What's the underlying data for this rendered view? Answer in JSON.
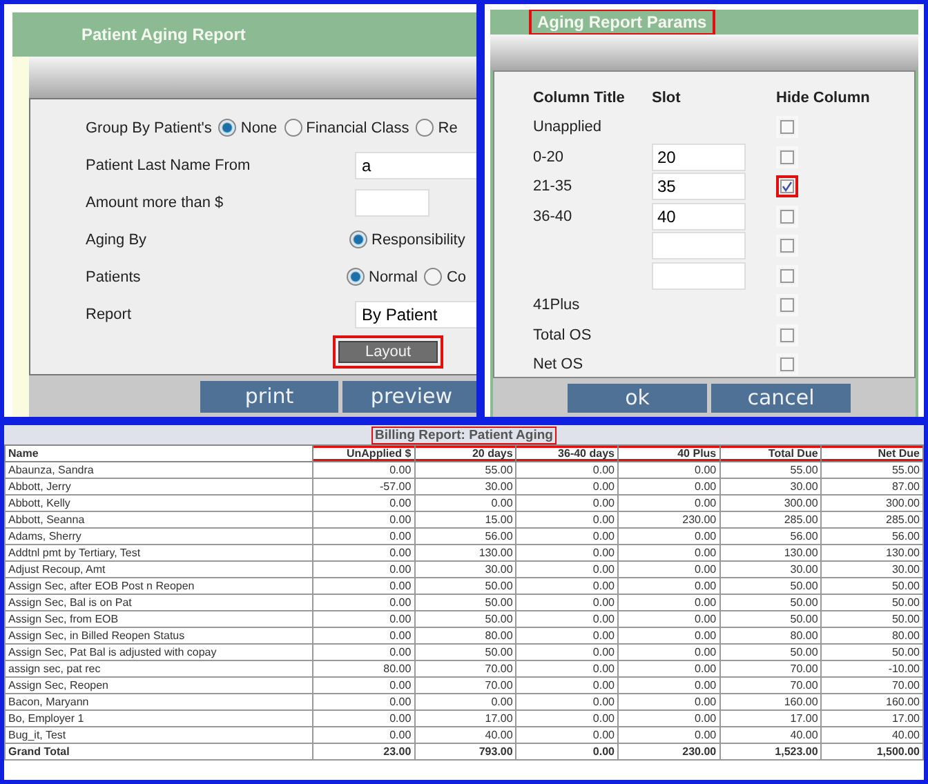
{
  "patient_aging_report": {
    "title": "Patient Aging Report",
    "group_by": {
      "label": "Group By Patient's",
      "options": [
        {
          "label": "None",
          "selected": true
        },
        {
          "label": "Financial Class",
          "selected": false
        },
        {
          "label": "Re",
          "selected": false
        }
      ]
    },
    "last_name_from": {
      "label": "Patient Last Name From",
      "value": "a"
    },
    "amount_more_than": {
      "label": "Amount more than $"
    },
    "aging_by": {
      "label": "Aging By",
      "options": [
        {
          "label": "Responsibility",
          "selected": true
        }
      ]
    },
    "patients": {
      "label": "Patients",
      "options": [
        {
          "label": "Normal",
          "selected": true
        },
        {
          "label": "Co",
          "selected": false
        }
      ]
    },
    "report": {
      "label": "Report",
      "value": "By Patient"
    },
    "layout_button": {
      "label": "Layout",
      "highlighted": true
    },
    "buttons": [
      "print",
      "preview"
    ]
  },
  "aging_report_params": {
    "title": "Aging Report Params",
    "title_highlighted": true,
    "columns": [
      "Column Title",
      "Slot",
      "Hide Column"
    ],
    "rows": [
      {
        "kind": "fixed",
        "title": "Unapplied",
        "hidden": false,
        "highlighted": false
      },
      {
        "kind": "slot",
        "title": "0-20",
        "slot": "20",
        "hidden": false,
        "highlighted": false
      },
      {
        "kind": "slot",
        "title": "21-35",
        "slot": "35",
        "hidden": true,
        "highlighted": true
      },
      {
        "kind": "slot",
        "title": "36-40",
        "slot": "40",
        "hidden": false,
        "highlighted": false
      },
      {
        "kind": "slot",
        "hidden": false,
        "highlighted": false
      },
      {
        "kind": "slot",
        "hidden": false,
        "highlighted": false
      },
      {
        "kind": "fixed",
        "title": "41Plus",
        "hidden": false,
        "highlighted": false
      },
      {
        "kind": "fixed",
        "title": "Total OS",
        "hidden": false,
        "highlighted": false
      },
      {
        "kind": "fixed",
        "title": "Net OS",
        "hidden": false,
        "highlighted": false
      }
    ],
    "buttons": [
      "ok",
      "cancel"
    ]
  },
  "billing_report": {
    "title": "Billing Report: Patient Aging",
    "title_highlighted": true,
    "columns": [
      {
        "label": "Name",
        "highlighted": false
      },
      {
        "label": "UnApplied $",
        "highlighted": true
      },
      {
        "label": "20 days",
        "highlighted": true
      },
      {
        "label": "36-40 days",
        "highlighted": true
      },
      {
        "label": "40 Plus",
        "highlighted": true
      },
      {
        "label": "Total Due",
        "highlighted": true
      },
      {
        "label": "Net Due",
        "highlighted": true
      }
    ],
    "rows": [
      [
        "Abaunza, Sandra",
        "0.00",
        "55.00",
        "0.00",
        "0.00",
        "55.00",
        "55.00"
      ],
      [
        "Abbott, Jerry",
        "-57.00",
        "30.00",
        "0.00",
        "0.00",
        "30.00",
        "87.00"
      ],
      [
        "Abbott, Kelly",
        "0.00",
        "0.00",
        "0.00",
        "0.00",
        "300.00",
        "300.00"
      ],
      [
        "Abbott, Seanna",
        "0.00",
        "15.00",
        "0.00",
        "230.00",
        "285.00",
        "285.00"
      ],
      [
        "Adams, Sherry",
        "0.00",
        "56.00",
        "0.00",
        "0.00",
        "56.00",
        "56.00"
      ],
      [
        "Addtnl pmt by Tertiary, Test",
        "0.00",
        "130.00",
        "0.00",
        "0.00",
        "130.00",
        "130.00"
      ],
      [
        "Adjust Recoup, Amt",
        "0.00",
        "30.00",
        "0.00",
        "0.00",
        "30.00",
        "30.00"
      ],
      [
        "Assign Sec, after EOB Post n Reopen",
        "0.00",
        "50.00",
        "0.00",
        "0.00",
        "50.00",
        "50.00"
      ],
      [
        "Assign Sec, Bal is on Pat",
        "0.00",
        "50.00",
        "0.00",
        "0.00",
        "50.00",
        "50.00"
      ],
      [
        "Assign Sec, from EOB",
        "0.00",
        "50.00",
        "0.00",
        "0.00",
        "50.00",
        "50.00"
      ],
      [
        "Assign Sec, in Billed Reopen Status",
        "0.00",
        "80.00",
        "0.00",
        "0.00",
        "80.00",
        "80.00"
      ],
      [
        "Assign Sec, Pat Bal is adjusted with copay",
        "0.00",
        "50.00",
        "0.00",
        "0.00",
        "50.00",
        "50.00"
      ],
      [
        "assign sec, pat rec",
        "80.00",
        "70.00",
        "0.00",
        "0.00",
        "70.00",
        "-10.00"
      ],
      [
        "Assign Sec, Reopen",
        "0.00",
        "70.00",
        "0.00",
        "0.00",
        "70.00",
        "70.00"
      ],
      [
        "Bacon, Maryann",
        "0.00",
        "0.00",
        "0.00",
        "0.00",
        "160.00",
        "160.00"
      ],
      [
        "Bo, Employer 1",
        "0.00",
        "17.00",
        "0.00",
        "0.00",
        "17.00",
        "17.00"
      ],
      [
        "Bug_it, Test",
        "0.00",
        "40.00",
        "0.00",
        "0.00",
        "40.00",
        "40.00"
      ]
    ],
    "total": [
      "Grand Total",
      "23.00",
      "793.00",
      "0.00",
      "230.00",
      "1,523.00",
      "1,500.00"
    ]
  }
}
